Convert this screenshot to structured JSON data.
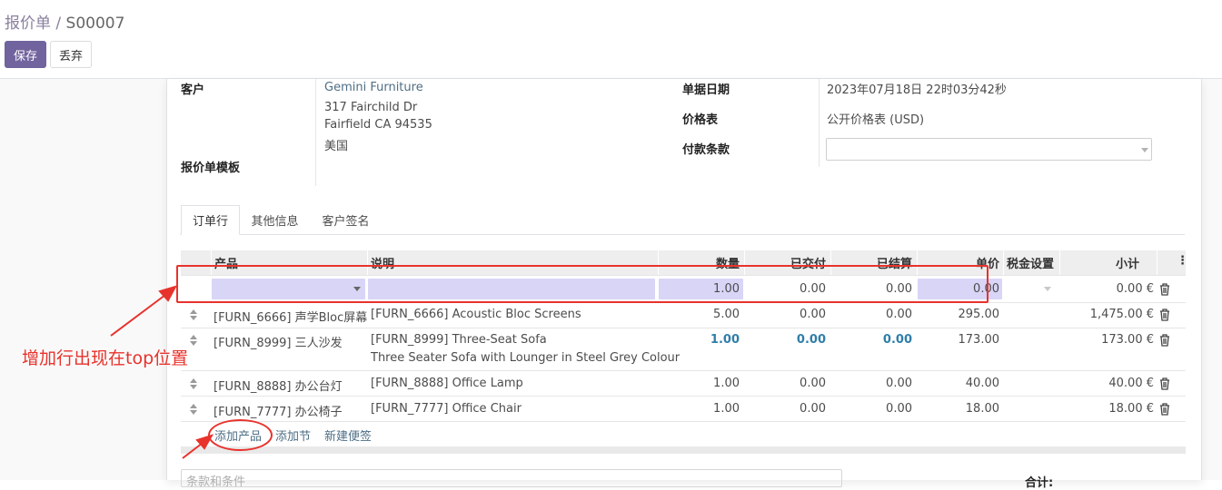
{
  "breadcrumb": {
    "parent": "报价单",
    "separator": " / ",
    "current": "S00007"
  },
  "buttons": {
    "save": "保存",
    "discard": "丢弃"
  },
  "form": {
    "customer_label": "客户",
    "customer_name": "Gemini Furniture",
    "customer_address": [
      "317 Fairchild Dr",
      "Fairfield CA 94535",
      "美国"
    ],
    "template_label": "报价单模板",
    "date_label": "单据日期",
    "date_value": "2023年07月18日 22时03分42秒",
    "pricelist_label": "价格表",
    "pricelist_value": "公开价格表 (USD)",
    "payment_terms_label": "付款条款",
    "payment_terms_value": ""
  },
  "tabs": [
    "订单行",
    "其他信息",
    "客户签名"
  ],
  "table": {
    "headers": {
      "product": "产品",
      "description": "说明",
      "qty": "数量",
      "delivered": "已交付",
      "invoiced": "已结算",
      "unit_price": "单价",
      "taxes": "税金设置",
      "subtotal": "小计"
    },
    "new_row": {
      "qty": "1.00",
      "delivered": "0.00",
      "invoiced": "0.00",
      "unit_price": "0.00",
      "subtotal": "0.00 €"
    },
    "rows": [
      {
        "product": "[FURN_6666] 声学Bloc屏幕",
        "description": "[FURN_6666] Acoustic Bloc Screens",
        "description2": "",
        "qty": "5.00",
        "delivered": "0.00",
        "invoiced": "0.00",
        "unit_price": "295.00",
        "subtotal": "1,475.00 €"
      },
      {
        "product": "[FURN_8999] 三人沙发",
        "description": "[FURN_8999] Three-Seat Sofa",
        "description2": "Three Seater Sofa with Lounger in Steel Grey Colour",
        "qty": "1.00",
        "delivered": "0.00",
        "invoiced": "0.00",
        "unit_price": "173.00",
        "subtotal": "173.00 €"
      },
      {
        "product": "[FURN_8888] 办公台灯",
        "description": "[FURN_8888] Office Lamp",
        "description2": "",
        "qty": "1.00",
        "delivered": "0.00",
        "invoiced": "0.00",
        "unit_price": "40.00",
        "subtotal": "40.00 €"
      },
      {
        "product": "[FURN_7777] 办公椅子",
        "description": "[FURN_7777] Office Chair",
        "description2": "",
        "qty": "1.00",
        "delivered": "0.00",
        "invoiced": "0.00",
        "unit_price": "18.00",
        "subtotal": "18.00 €"
      }
    ],
    "add_links": {
      "product": "添加产品",
      "section": "添加节",
      "note": "新建便签"
    }
  },
  "footer": {
    "terms_placeholder": "条款和条件",
    "total_label": "合计:"
  },
  "annotation": {
    "text": "增加行出现在top位置",
    "color": "#e8322c"
  },
  "colors": {
    "primary": "#71639e",
    "link": "#4e6e85",
    "edit_highlight": "#d8d5f7",
    "emphasis_number": "#2f7ea9"
  }
}
